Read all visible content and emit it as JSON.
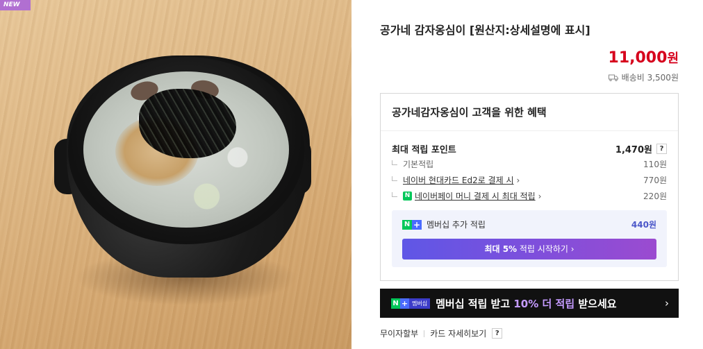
{
  "image": {
    "badge": "NEW"
  },
  "product": {
    "title": "공가네 감자옹심이 [원산지:상세설명에 표시]",
    "price": "11,000",
    "price_unit": "원",
    "shipping": "배송비 3,500원"
  },
  "benefits": {
    "heading": "공가네감자옹심이 고객을 위한 혜택",
    "max_points_label": "최대 적립 포인트",
    "max_points_value": "1,470원",
    "help": "?",
    "items": [
      {
        "label": "기본적립",
        "value": "110원"
      },
      {
        "label": "네이버 현대카드 Ed2로 결제 시",
        "value": "770원"
      },
      {
        "label": "네이버페이 머니 결제 시 최대 적립",
        "value": "220원"
      }
    ],
    "membership": {
      "label": "멤버십 추가 적립",
      "value": "440원",
      "button_bold": "최대 5%",
      "button_rest": " 적립 시작하기 ›"
    }
  },
  "promo": {
    "badge_n": "N",
    "badge_plus": "+",
    "badge_text": "멤버십",
    "text_pre": "멤버십 적립 받고 ",
    "text_hl": "10% 더 적립",
    "text_post": " 받으세요",
    "arrow": "›"
  },
  "links": {
    "installment": "무이자할부",
    "card_detail": "카드 자세히보기",
    "help": "?"
  },
  "colors": {
    "price": "#d6001c",
    "naver_green": "#03c75a",
    "membership_accent": "#4b57c9",
    "badge_purple": "#b16fd1"
  }
}
